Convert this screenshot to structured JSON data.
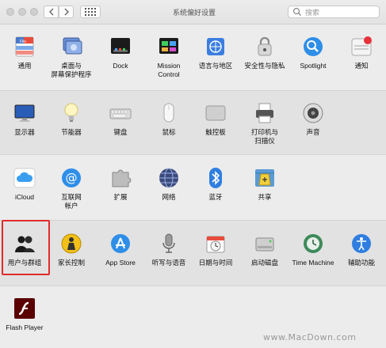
{
  "window": {
    "title": "系统偏好设置",
    "search_placeholder": "搜索"
  },
  "sections": [
    [
      {
        "label": "通用",
        "icon": "general-icon"
      },
      {
        "label": "桌面与\n屏幕保护程序",
        "icon": "desktop-screensaver-icon"
      },
      {
        "label": "Dock",
        "icon": "dock-icon"
      },
      {
        "label": "Mission\nControl",
        "icon": "mission-control-icon"
      },
      {
        "label": "语言与地区",
        "icon": "language-region-icon"
      },
      {
        "label": "安全性与隐私",
        "icon": "security-privacy-icon"
      },
      {
        "label": "Spotlight",
        "icon": "spotlight-icon"
      },
      {
        "label": "通知",
        "icon": "notifications-icon"
      }
    ],
    [
      {
        "label": "显示器",
        "icon": "displays-icon"
      },
      {
        "label": "节能器",
        "icon": "energy-saver-icon"
      },
      {
        "label": "键盘",
        "icon": "keyboard-icon"
      },
      {
        "label": "鼠标",
        "icon": "mouse-icon"
      },
      {
        "label": "触控板",
        "icon": "trackpad-icon"
      },
      {
        "label": "打印机与\n扫描仪",
        "icon": "printers-scanners-icon"
      },
      {
        "label": "声音",
        "icon": "sound-icon"
      }
    ],
    [
      {
        "label": "iCloud",
        "icon": "icloud-icon"
      },
      {
        "label": "互联网\n帐户",
        "icon": "internet-accounts-icon"
      },
      {
        "label": "扩展",
        "icon": "extensions-icon"
      },
      {
        "label": "网络",
        "icon": "network-icon"
      },
      {
        "label": "蓝牙",
        "icon": "bluetooth-icon"
      },
      {
        "label": "共享",
        "icon": "sharing-icon"
      }
    ],
    [
      {
        "label": "用户与群组",
        "icon": "users-groups-icon"
      },
      {
        "label": "家长控制",
        "icon": "parental-controls-icon"
      },
      {
        "label": "App Store",
        "icon": "app-store-icon"
      },
      {
        "label": "听写与语音",
        "icon": "dictation-speech-icon"
      },
      {
        "label": "日期与时间",
        "icon": "date-time-icon"
      },
      {
        "label": "启动磁盘",
        "icon": "startup-disk-icon"
      },
      {
        "label": "Time Machine",
        "icon": "time-machine-icon"
      },
      {
        "label": "辅助功能",
        "icon": "accessibility-icon"
      }
    ],
    [
      {
        "label": "Flash Player",
        "icon": "flash-player-icon"
      }
    ]
  ],
  "selected_pane": "用户与群组",
  "watermark": "www.MacDown.com",
  "colors": {
    "highlight": "#e02b2b"
  }
}
